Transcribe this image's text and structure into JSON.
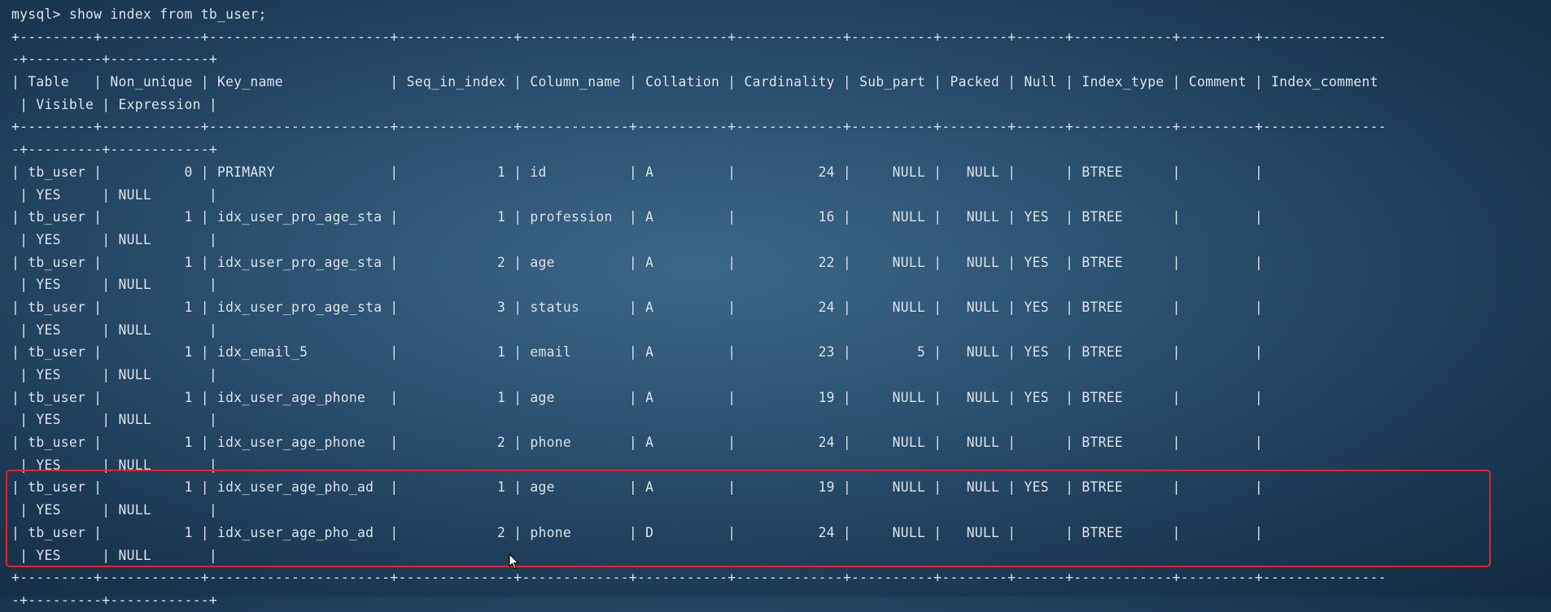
{
  "terminal": {
    "lines": [
      "mysql> show index from tb_user;",
      "+---------+------------+----------------------+--------------+-------------+-----------+-------------+----------+--------+------+------------+---------+---------------",
      "-+---------+------------+",
      "| Table   | Non_unique | Key_name             | Seq_in_index | Column_name | Collation | Cardinality | Sub_part | Packed | Null | Index_type | Comment | Index_comment",
      " | Visible | Expression |",
      "+---------+------------+----------------------+--------------+-------------+-----------+-------------+----------+--------+------+------------+---------+---------------",
      "-+---------+------------+",
      "| tb_user |          0 | PRIMARY              |            1 | id          | A         |          24 |     NULL |   NULL |      | BTREE      |         |",
      " | YES     | NULL       |",
      "| tb_user |          1 | idx_user_pro_age_sta |            1 | profession  | A         |          16 |     NULL |   NULL | YES  | BTREE      |         |",
      " | YES     | NULL       |",
      "| tb_user |          1 | idx_user_pro_age_sta |            2 | age         | A         |          22 |     NULL |   NULL | YES  | BTREE      |         |",
      " | YES     | NULL       |",
      "| tb_user |          1 | idx_user_pro_age_sta |            3 | status      | A         |          24 |     NULL |   NULL | YES  | BTREE      |         |",
      " | YES     | NULL       |",
      "| tb_user |          1 | idx_email_5          |            1 | email       | A         |          23 |        5 |   NULL | YES  | BTREE      |         |",
      " | YES     | NULL       |",
      "| tb_user |          1 | idx_user_age_phone   |            1 | age         | A         |          19 |     NULL |   NULL | YES  | BTREE      |         |",
      " | YES     | NULL       |",
      "| tb_user |          1 | idx_user_age_phone   |            2 | phone       | A         |          24 |     NULL |   NULL |      | BTREE      |         |",
      " | YES     | NULL       |",
      "| tb_user |          1 | idx_user_age_pho_ad  |            1 | age         | A         |          19 |     NULL |   NULL | YES  | BTREE      |         |",
      " | YES     | NULL       |",
      "| tb_user |          1 | idx_user_age_pho_ad  |            2 | phone       | D         |          24 |     NULL |   NULL |      | BTREE      |         |",
      " | YES     | NULL       |",
      "+---------+------------+----------------------+--------------+-------------+-----------+-------------+----------+--------+------+------------+---------+---------------",
      "-+---------+------------+"
    ]
  },
  "colors": {
    "text": "#dfe8f0",
    "highlight": "#e0242a",
    "background_center": "#3c6688",
    "background_edge": "#122a40"
  },
  "cursor_icon": "mouse-pointer-icon"
}
